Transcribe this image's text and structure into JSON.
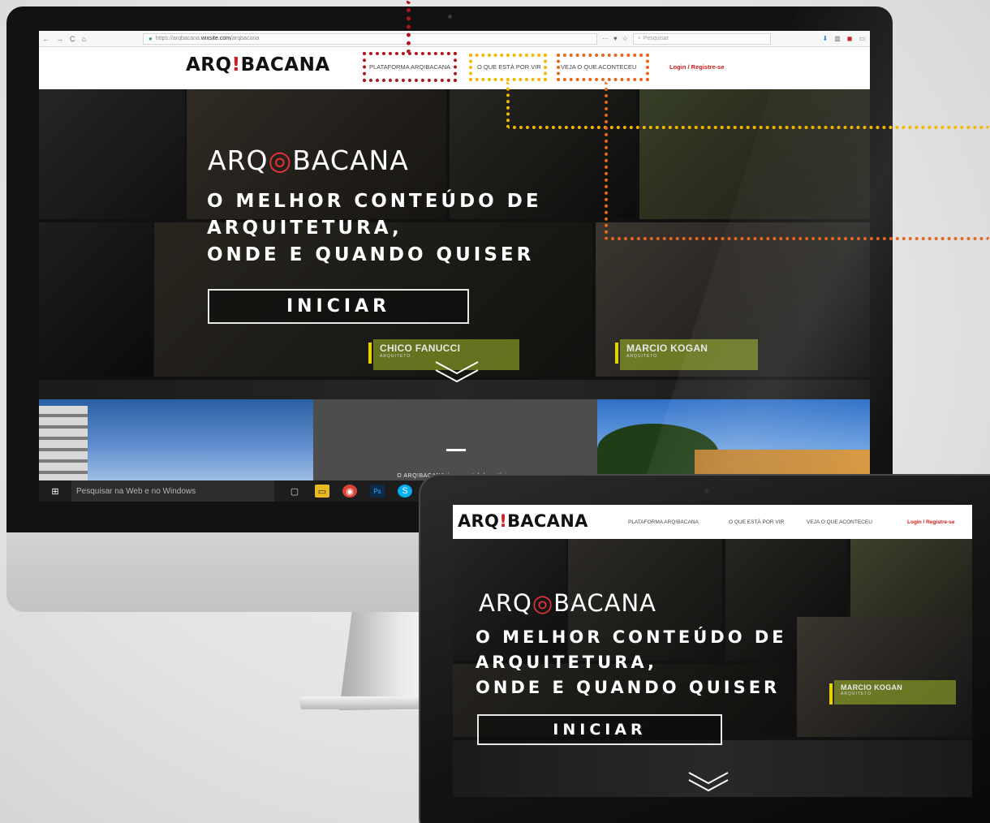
{
  "browser": {
    "url_prefix": "https://arqbacana.",
    "url_domain": "wixsite.com",
    "url_path": "/arqbacana",
    "search_placeholder": "Pesquisar",
    "nav_glyphs": [
      "←",
      "→",
      "C",
      "⌂"
    ],
    "tool_glyphs": [
      "···",
      "♥",
      "☆"
    ]
  },
  "site": {
    "logo_pre": "ARQ",
    "logo_bang": "!",
    "logo_post": "BACANA",
    "nav": {
      "plataforma": "PLATAFORMA ARQ!BACANA",
      "por_vir": "O QUE ESTÁ POR VIR",
      "aconteceu": "VEJA O QUE ACONTECEU",
      "login": "Login / Registre-se"
    }
  },
  "hero": {
    "logo_pre": "ARQ",
    "logo_mid": "◎",
    "logo_post": "BACANA",
    "tagline_1": "O MELHOR CONTEÚDO DE",
    "tagline_2": "ARQUITETURA,",
    "tagline_3": "ONDE E QUANDO QUISER",
    "cta": "INICIAR",
    "speakers": [
      {
        "name": "CHICO FANUCCI",
        "role": "ARQUITETO"
      },
      {
        "name": "MARCIO KOGAN",
        "role": "ARQUITETO"
      }
    ]
  },
  "about": {
    "text": "O ARQ!BACANA é um portal de notícias"
  },
  "taskbar": {
    "search_placeholder": "Pesquisar na Web e no Windows"
  },
  "tablet": {
    "speaker": {
      "name": "MARCIO KOGAN",
      "role": "ARQUITETO"
    }
  },
  "colors": {
    "annotation_red": "#b0141c",
    "annotation_yellow": "#f3b700",
    "annotation_orange": "#e8661d",
    "brand_red": "#d11a1a",
    "speaker_bar_green": "#a5be28"
  }
}
